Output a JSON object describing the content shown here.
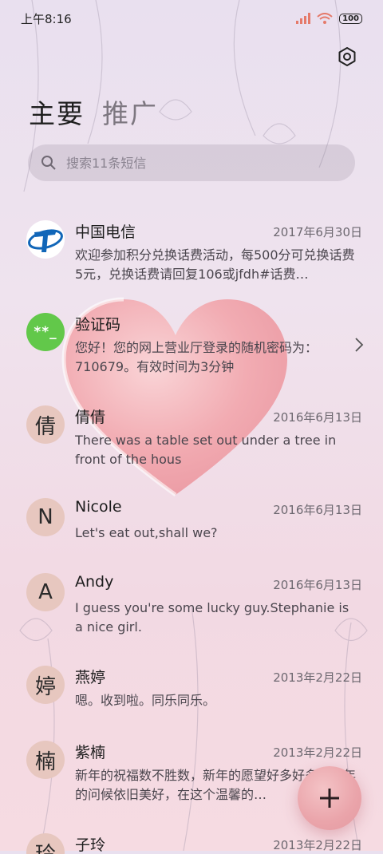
{
  "status": {
    "time": "上午8:16",
    "battery": "100"
  },
  "tabs": [
    {
      "label": "主要"
    },
    {
      "label": "推广"
    }
  ],
  "search": {
    "placeholder": "搜索11条短信"
  },
  "conversations": [
    {
      "name": "中国电信",
      "date": "2017年6月30日",
      "preview": "欢迎参加积分兑换话费活动，每500分可兑换话费5元，兑换话费请回复106或jfdh#话费…",
      "avatar_text": ""
    },
    {
      "name": "验证码",
      "date": "",
      "preview": "您好！您的网上营业厅登录的随机密码为：710679。有效时间为3分钟",
      "avatar_text": "**_"
    },
    {
      "name": "倩倩",
      "date": "2016年6月13日",
      "preview": "There was a table set out under a tree in front of the hous",
      "avatar_text": "倩"
    },
    {
      "name": "Nicole",
      "date": "2016年6月13日",
      "preview": "Let's eat out,shall we?",
      "avatar_text": "N"
    },
    {
      "name": "Andy",
      "date": "2016年6月13日",
      "preview": "I guess you're some lucky guy.Stephanie is a nice girl.",
      "avatar_text": "A"
    },
    {
      "name": "燕婷",
      "date": "2013年2月22日",
      "preview": "嗯。收到啦。同乐同乐。",
      "avatar_text": "婷"
    },
    {
      "name": "紫楠",
      "date": "2013年2月22日",
      "preview": "新年的祝福数不胜数，新年的愿望好多好多，新年的问候依旧美好，在这个温馨的…",
      "avatar_text": "楠"
    },
    {
      "name": "子玲",
      "date": "2013年2月22日",
      "preview": "",
      "avatar_text": "玲"
    }
  ],
  "colors": {
    "brand_blue": "#1166b8",
    "verify_green": "#62c84a",
    "avatar_bg": "#e7c7bf",
    "fab": "#eaa4aa"
  }
}
